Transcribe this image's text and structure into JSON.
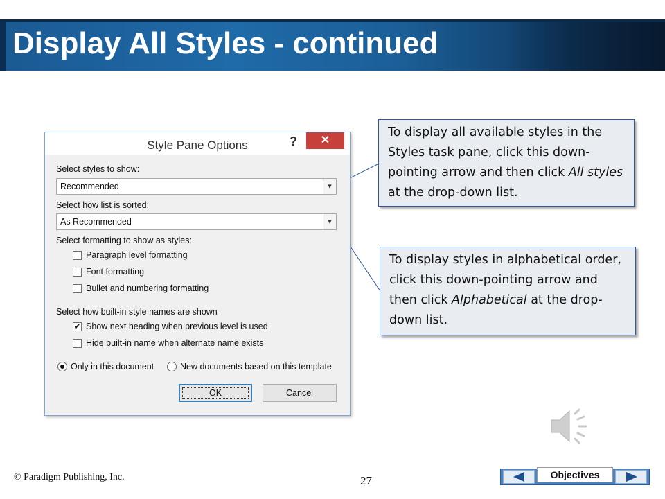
{
  "slide": {
    "title": "Display All Styles - continued",
    "copyright": "© Paradigm Publishing, Inc.",
    "page_number": "27"
  },
  "dialog": {
    "title": "Style Pane Options",
    "help_glyph": "?",
    "close_glyph": "✕",
    "select_styles_label": "Select styles to show:",
    "select_styles_value": "Recommended",
    "sort_label": "Select how list is sorted:",
    "sort_value": "As Recommended",
    "formatting_label": "Select formatting to show as styles:",
    "formatting_options": [
      {
        "label": "Paragraph level formatting",
        "checked": false
      },
      {
        "label": "Font formatting",
        "checked": false
      },
      {
        "label": "Bullet and numbering formatting",
        "checked": false
      }
    ],
    "builtin_label": "Select how built-in style names are shown",
    "builtin_options": [
      {
        "label": "Show next heading when previous level is used",
        "checked": true
      },
      {
        "label": "Hide built-in name when alternate name exists",
        "checked": false
      }
    ],
    "scope_options": [
      {
        "label": "Only in this document",
        "selected": true
      },
      {
        "label": "New documents based on this template",
        "selected": false
      }
    ],
    "ok_label": "OK",
    "cancel_label": "Cancel"
  },
  "callouts": {
    "first": {
      "text_before": "To display all available styles in the Styles task pane, click this down-pointing arrow and then click ",
      "emphasis": "All styles",
      "text_after": " at the drop-down list."
    },
    "second": {
      "text_before": "To display styles in alphabetical order, click this down-pointing arrow and then click ",
      "emphasis": "Alphabetical",
      "text_after": " at the drop-down list."
    }
  },
  "nav": {
    "objectives_label": "Objectives"
  },
  "icons": [
    "speaker-icon",
    "prev-arrow-icon",
    "next-arrow-icon",
    "checkmark-icon",
    "chevron-down-icon"
  ]
}
